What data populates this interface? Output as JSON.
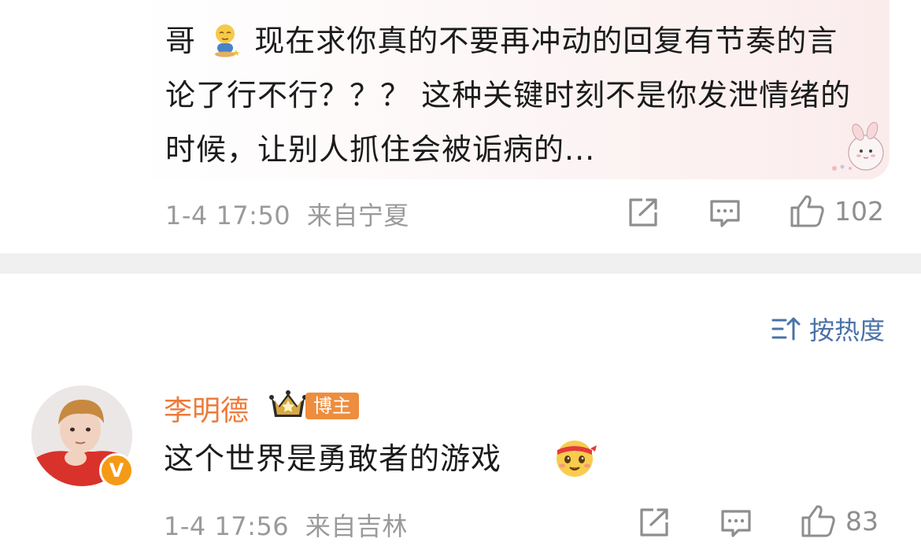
{
  "comment1": {
    "text_before_emoji": "哥",
    "emoji": "pleading-kneel-emoji",
    "text_after_emoji": "现在求你真的不要再冲动的回复有节奏的言论了行不行？？？ 这种关键时刻不是你发泄情绪的时候，让别人抓住会被诟病的...",
    "sticker": "cute-bunny-sticker",
    "time": "1-4 17:50",
    "location": "来自宁夏",
    "like_count": "102"
  },
  "sort": {
    "label": "按热度",
    "icon": "sort-icon"
  },
  "comment2": {
    "username": "李明德",
    "tag": "博主",
    "verified_badge": "V",
    "text": "这个世界是勇敢者的游戏",
    "emoji": "headband-smile-emoji",
    "time": "1-4 17:56",
    "location": "来自吉林",
    "like_count": "83"
  },
  "colors": {
    "username": "#ee7a3a",
    "sort": "#4a73a8",
    "meta": "#9a9a9a",
    "tag": "#ee8d3e"
  }
}
